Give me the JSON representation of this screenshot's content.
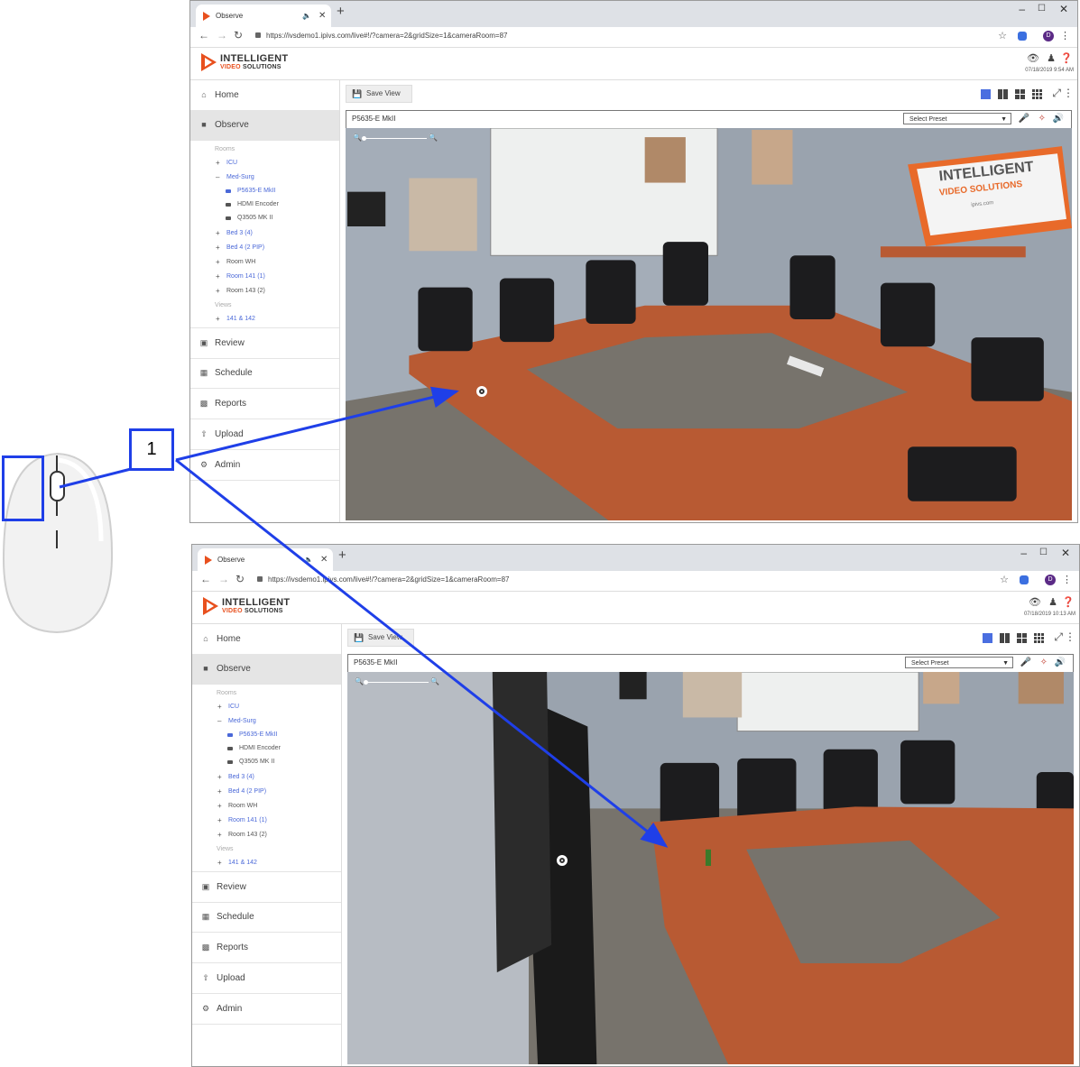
{
  "callout": {
    "number": "1"
  },
  "screenshots": [
    {
      "tab_title": "Observe",
      "url": "https://ivsdemo1.ipivs.com/live#!/?camera=2&gridSize=1&cameraRoom=87",
      "profile_letter": "D",
      "logo_line1": "INTELLIGENT",
      "logo_line2a": "VIDEO",
      "logo_line2b": "SOLUTIONS",
      "datetime": "07/18/2019 9:54 AM",
      "camera_name": "P5635-E MkII",
      "preset_placeholder": "Select Preset",
      "save_view": "Save View"
    },
    {
      "tab_title": "Observe",
      "url": "https://ivsdemo1.ipivs.com/live#!/?camera=2&gridSize=1&cameraRoom=87",
      "profile_letter": "D",
      "logo_line1": "INTELLIGENT",
      "logo_line2a": "VIDEO",
      "logo_line2b": "SOLUTIONS",
      "datetime": "07/18/2019 10:13 AM",
      "camera_name": "P5635-E MkII",
      "preset_placeholder": "Select Preset",
      "save_view": "Save View"
    }
  ],
  "nav": {
    "home": "Home",
    "observe": "Observe",
    "review": "Review",
    "schedule": "Schedule",
    "reports": "Reports",
    "upload": "Upload",
    "admin": "Admin"
  },
  "tree": {
    "rooms_heading": "Rooms",
    "icu": "ICU",
    "med_surg": "Med-Surg",
    "cam1": "P5635-E MkII",
    "cam2": "HDMI Encoder",
    "cam3": "Q3505 MK II",
    "bed3": "Bed 3 (4)",
    "bed4": "Bed 4 (2 PIP)",
    "room_wh": "Room WH",
    "room141": "Room 141 (1)",
    "room143": "Room 143 (2)",
    "views_heading": "Views",
    "view1": "141 & 142"
  },
  "video_sign": {
    "line1": "INTELLIGENT",
    "line2": "VIDEO SOLUTIONS",
    "line3": "ipivs.com"
  },
  "icons": [
    "play-logo-icon",
    "speaker-icon",
    "close-icon",
    "plus-icon",
    "minimize-icon",
    "maximize-icon",
    "back-icon",
    "forward-icon",
    "reload-icon",
    "lock-icon",
    "star-icon",
    "extension-icon",
    "menu-icon",
    "eye-icon",
    "user-icon",
    "help-icon",
    "home-icon",
    "camera-icon",
    "film-icon",
    "calendar-icon",
    "chart-icon",
    "upload-icon",
    "gear-icon",
    "save-icon",
    "microphone-icon",
    "ptz-icon",
    "volume-icon",
    "zoom-out-icon",
    "zoom-in-icon"
  ],
  "colors": {
    "accent": "#4a6ee0",
    "brand_orange": "#e8501e",
    "callout_blue": "#1f3fe8",
    "table_wood": "#b85a33"
  }
}
